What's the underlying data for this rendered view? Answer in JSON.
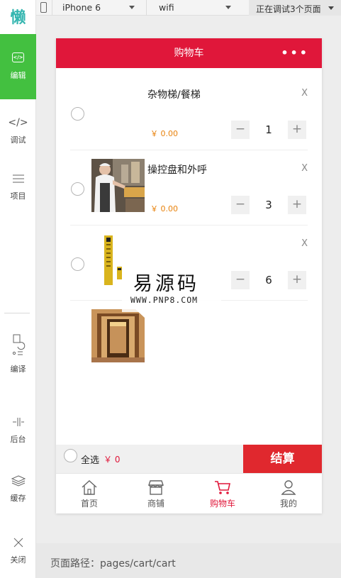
{
  "app": {
    "logo_char": "懒"
  },
  "sidebar": {
    "items": [
      {
        "label": "编辑",
        "icon": "code-box-icon",
        "active": true
      },
      {
        "label": "调试",
        "icon": "code-icon"
      },
      {
        "label": "项目",
        "icon": "list-icon"
      },
      {
        "label": "编译",
        "icon": "compile-icon"
      },
      {
        "label": "后台",
        "icon": "backend-icon"
      },
      {
        "label": "缓存",
        "icon": "layers-icon"
      },
      {
        "label": "关闭",
        "icon": "close-icon"
      }
    ]
  },
  "toolbar": {
    "device": "iPhone 6",
    "network": "wifi",
    "debug_status": "正在调试3个页面"
  },
  "page": {
    "title": "购物车",
    "menu_glyph": "•••"
  },
  "cart": {
    "items": [
      {
        "name": "杂物梯/餐梯",
        "price": "￥ 0.00",
        "qty": "1",
        "thumb": "none"
      },
      {
        "name": "操控盘和外呼",
        "price": "￥ 0.00",
        "qty": "3",
        "thumb": "chef-photo"
      },
      {
        "name": "",
        "price": "",
        "qty": "6",
        "thumb": "control-panel-photo"
      },
      {
        "name": "",
        "price": "",
        "qty": "",
        "thumb": "elevator-car-photo"
      }
    ],
    "delete_label": "X",
    "minus_label": "−",
    "plus_label": "+"
  },
  "watermark": {
    "title": "易源码",
    "url": "WWW.PNP8.COM"
  },
  "footer": {
    "select_all": "全选",
    "total": "￥ 0",
    "checkout": "结算"
  },
  "tabbar": {
    "items": [
      {
        "label": "首页",
        "icon": "home-icon"
      },
      {
        "label": "商铺",
        "icon": "shop-icon"
      },
      {
        "label": "购物车",
        "icon": "cart-icon",
        "active": true
      },
      {
        "label": "我的",
        "icon": "user-icon"
      }
    ]
  },
  "pathbar": {
    "text": "页面路径：pages/cart/cart"
  },
  "colors": {
    "primary": "#e0173a",
    "active_side": "#43c040",
    "price": "#e8820c"
  }
}
